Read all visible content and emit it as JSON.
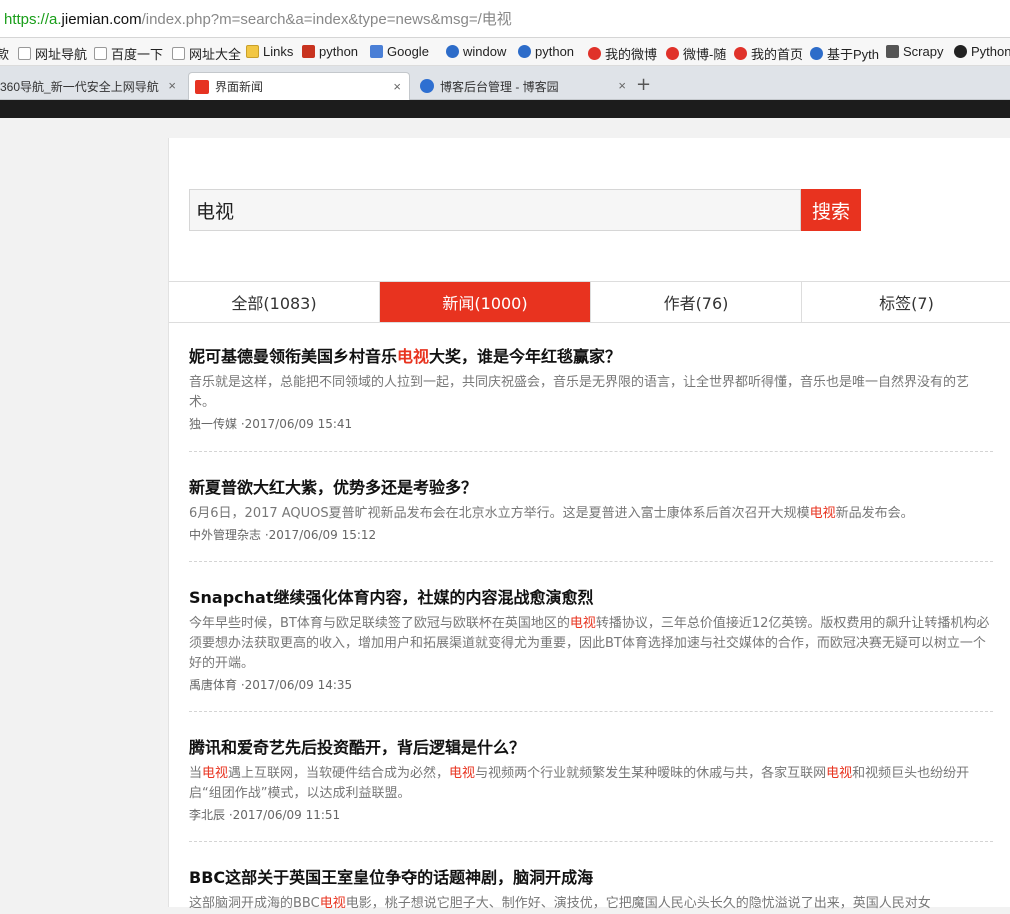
{
  "address": {
    "proto": "https://a.",
    "host": "jiemian.com",
    "path": "/index.php?m=search&a=index&type=news&msg=/电视"
  },
  "bookmarks": [
    {
      "label": "款",
      "icon": "none"
    },
    {
      "label": "网址导航",
      "icon": "doc-icon"
    },
    {
      "label": "百度一下",
      "icon": "doc-icon"
    },
    {
      "label": "网址大全",
      "icon": "doc-icon"
    },
    {
      "label": "Links",
      "icon": "folder-icon"
    },
    {
      "label": "python",
      "icon": "python-icon"
    },
    {
      "label": "Google",
      "icon": "google-icon"
    },
    {
      "label": "window",
      "icon": "globe-icon"
    },
    {
      "label": "python",
      "icon": "globe-icon"
    },
    {
      "label": "我的微博",
      "icon": "weibo-icon"
    },
    {
      "label": "微博-随",
      "icon": "weibo-icon"
    },
    {
      "label": "我的首页",
      "icon": "weibo-icon"
    },
    {
      "label": "基于Pyth",
      "icon": "globe-icon"
    },
    {
      "label": "Scrapy",
      "icon": "scrapy-icon"
    },
    {
      "label": "Python",
      "icon": "github-icon"
    }
  ],
  "tabs": [
    {
      "label": "360导航_新一代安全上网导航",
      "active": false
    },
    {
      "label": "界面新闻",
      "active": true
    },
    {
      "label": "博客后台管理 - 博客园",
      "active": false
    }
  ],
  "tab_new": "+",
  "tab_close": "×",
  "search": {
    "value": "电视",
    "button": "搜索"
  },
  "filters": [
    {
      "label": "全部(1083)",
      "active": false
    },
    {
      "label": "新闻(1000)",
      "active": true
    },
    {
      "label": "作者(76)",
      "active": false
    },
    {
      "label": "标签(7)",
      "active": false
    }
  ],
  "articles": [
    {
      "title": [
        {
          "t": "妮可基德曼领衔美国乡村音乐"
        },
        {
          "t": "电视",
          "hl": true
        },
        {
          "t": "大奖，谁是今年红毯赢家？"
        }
      ],
      "summary": [
        {
          "t": "音乐就是这样，总能把不同领域的人拉到一起，共同庆祝盛会，音乐是无界限的语言，让全世界都听得懂，音乐也是唯一自然界没有的艺术。"
        }
      ],
      "meta": "独一传媒 ·2017/06/09 15:41"
    },
    {
      "title": [
        {
          "t": "新夏普欲大红大紫，优势多还是考验多？"
        }
      ],
      "summary": [
        {
          "t": "6月6日，2017 AQUOS夏普旷视新品发布会在北京水立方举行。这是夏普进入富士康体系后首次召开大规模"
        },
        {
          "t": "电视",
          "hl": true
        },
        {
          "t": "新品发布会。"
        }
      ],
      "meta": "中外管理杂志 ·2017/06/09 15:12"
    },
    {
      "title": [
        {
          "t": "Snapchat继续强化体育内容，社媒的内容混战愈演愈烈"
        }
      ],
      "summary": [
        {
          "t": "今年早些时候，BT体育与欧足联续签了欧冠与欧联杯在英国地区的"
        },
        {
          "t": "电视",
          "hl": true
        },
        {
          "t": "转播协议，三年总价值接近12亿英镑。版权费用的飙升让转播机构必须要想办法获取更高的收入，增加用户和拓展渠道就变得尤为重要，因此BT体育选择加速与社交媒体的合作，而欧冠决赛无疑可以树立一个好的开端。"
        }
      ],
      "meta": "禹唐体育 ·2017/06/09 14:35"
    },
    {
      "title": [
        {
          "t": "腾讯和爱奇艺先后投资酷开，背后逻辑是什么？"
        }
      ],
      "summary": [
        {
          "t": "当"
        },
        {
          "t": "电视",
          "hl": true
        },
        {
          "t": "遇上互联网，当软硬件结合成为必然，"
        },
        {
          "t": "电视",
          "hl": true
        },
        {
          "t": "与视频两个行业就频繁发生某种暧昧的休戚与共，各家互联网"
        },
        {
          "t": "电视",
          "hl": true
        },
        {
          "t": "和视频巨头也纷纷开启“组团作战”模式，以达成利益联盟。"
        }
      ],
      "meta": "李北辰 ·2017/06/09 11:51"
    },
    {
      "title": [
        {
          "t": "BBC这部关于英国王室皇位争夺的话题神剧，脑洞开成海"
        }
      ],
      "summary": [
        {
          "t": "这部脑洞开成海的BBC"
        },
        {
          "t": "电视",
          "hl": true
        },
        {
          "t": "电影，桃子想说它胆子大、制作好、演技优，它把魔国人民心头长久的隐忧溢说了出来，英国人民对女"
        }
      ],
      "meta": ""
    }
  ]
}
